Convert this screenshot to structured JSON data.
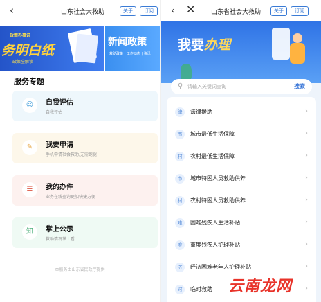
{
  "left": {
    "nav": {
      "back_icon": "‹",
      "title": "山东社会大救助",
      "about": "关于",
      "subscribe": "订阅"
    },
    "banner": {
      "card1": {
        "slogan": "政策办事说",
        "big": "务明白纸",
        "sub": "政策全解读"
      },
      "card2": {
        "big": "新闻政策",
        "sub": "救助政策 | 工作动态 | 资讯",
        "sub2": ""
      }
    },
    "section_title": "服务专题",
    "services": [
      {
        "name": "自我评估",
        "desc": "自我评估",
        "icon": "person-icon",
        "glyph": "☺"
      },
      {
        "name": "我要申请",
        "desc": "手机申请社会救助,无需跑腿",
        "icon": "form-icon",
        "glyph": "✎"
      },
      {
        "name": "我的办件",
        "desc": "业务在线查询更加快捷方便",
        "icon": "document-icon",
        "glyph": "☰"
      },
      {
        "name": "掌上公示",
        "desc": "救助情况掌上看",
        "icon": "publicity-icon",
        "glyph": "知"
      }
    ],
    "footer_note": "本服务由山东省民政厅提供"
  },
  "right": {
    "nav": {
      "back_icon": "‹",
      "close_icon": "✕",
      "title": "山东省社会大救助",
      "about": "关于",
      "subscribe": "订阅"
    },
    "hero": {
      "prefix": "我要",
      "highlight": "办理"
    },
    "search": {
      "placeholder": "请输入关键词查询",
      "button": "搜索"
    },
    "items": [
      {
        "tag": "律",
        "label": "法律援助"
      },
      {
        "tag": "市",
        "label": "城市最低生活保障"
      },
      {
        "tag": "村",
        "label": "农村最低生活保障"
      },
      {
        "tag": "市",
        "label": "城市特困人员救助供养"
      },
      {
        "tag": "村",
        "label": "农村特困人员救助供养"
      },
      {
        "tag": "难",
        "label": "困难残疾人生活补贴"
      },
      {
        "tag": "度",
        "label": "重度残疾人护理补贴"
      },
      {
        "tag": "济",
        "label": "经济困难老年人护理补贴"
      },
      {
        "tag": "时",
        "label": "临时救助"
      }
    ],
    "chevron": "›"
  },
  "watermark": "云南龙网"
}
